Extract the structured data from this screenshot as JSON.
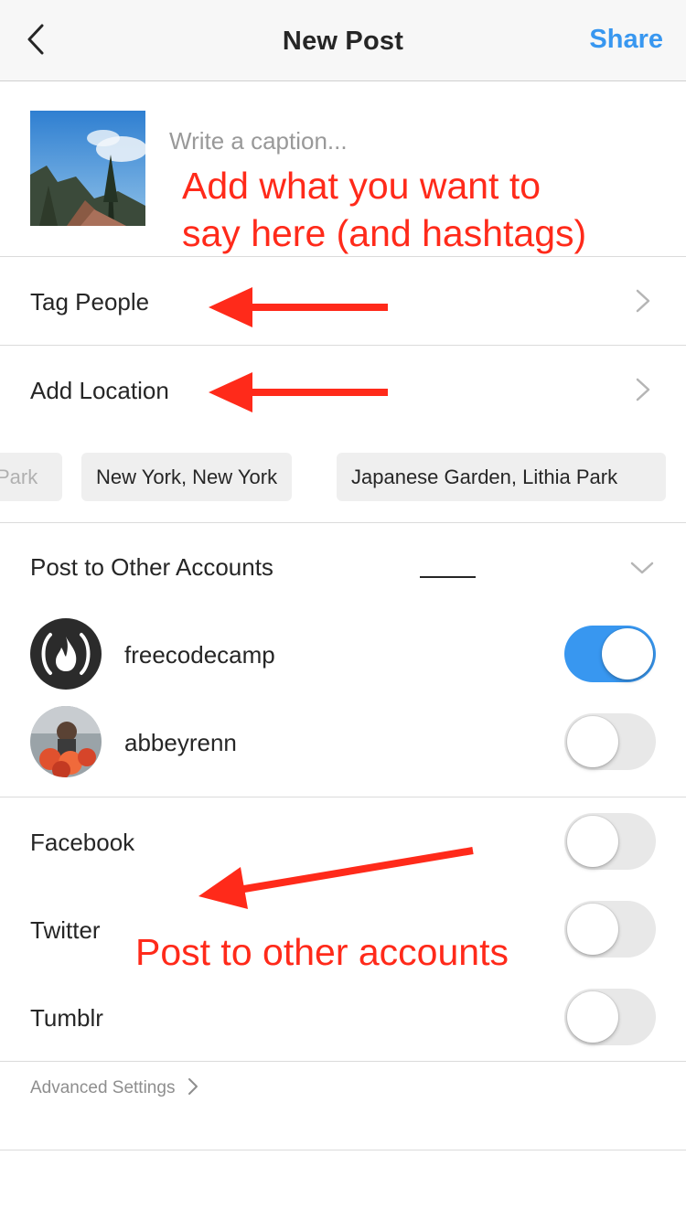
{
  "header": {
    "title": "New Post",
    "share_label": "Share"
  },
  "caption": {
    "placeholder": "Write a caption..."
  },
  "annotations": {
    "caption_note_line1": "Add what you want to",
    "caption_note_line2": "say here (and hashtags)",
    "accounts_note": "Post to other accounts",
    "color": "#ff2a1a"
  },
  "rows": {
    "tag_people": "Tag People",
    "add_location": "Add Location"
  },
  "location_chips": [
    "Park",
    "New York, New York",
    "Japanese Garden, Lithia Park"
  ],
  "other_accounts": {
    "heading": "Post to Other Accounts",
    "accounts": [
      {
        "name": "freecodecamp",
        "enabled": true
      },
      {
        "name": "abbeyrenn",
        "enabled": false
      }
    ]
  },
  "share_to": [
    {
      "name": "Facebook",
      "enabled": false
    },
    {
      "name": "Twitter",
      "enabled": false
    },
    {
      "name": "Tumblr",
      "enabled": false
    }
  ],
  "advanced_settings": "Advanced Settings",
  "colors": {
    "accent": "#3897f0",
    "divider": "#dbdbdb",
    "muted": "#8e8e8e"
  }
}
